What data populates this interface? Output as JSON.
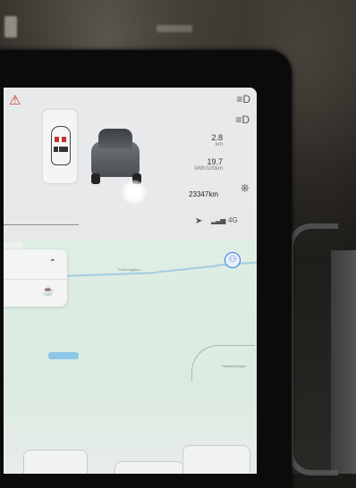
{
  "vehicle": {
    "trip_distance": "2.8",
    "trip_distance_unit": "km",
    "energy_consumption": "19.7",
    "energy_consumption_unit": "kWh/100km",
    "odometer": "23347km"
  },
  "status_bar": {
    "network": "4G"
  },
  "map": {
    "label_road_top": "Fornhusgatan",
    "label_road_right": "Hayfieldsvägen"
  },
  "icons": {
    "seatbelt": "seatbelt-warning-icon",
    "low_beam": "low-beam-icon",
    "high_beam": "high-beam-icon",
    "car_mode": "car-mode-icon",
    "navigation": "navigation-arrow-icon",
    "signal": "signal-bars-icon",
    "location": "my-location-icon",
    "collapse": "chevron-up-icon",
    "coffee": "coffee-icon"
  },
  "colors": {
    "warning": "#d0332f",
    "accent": "#2f7ee0"
  }
}
